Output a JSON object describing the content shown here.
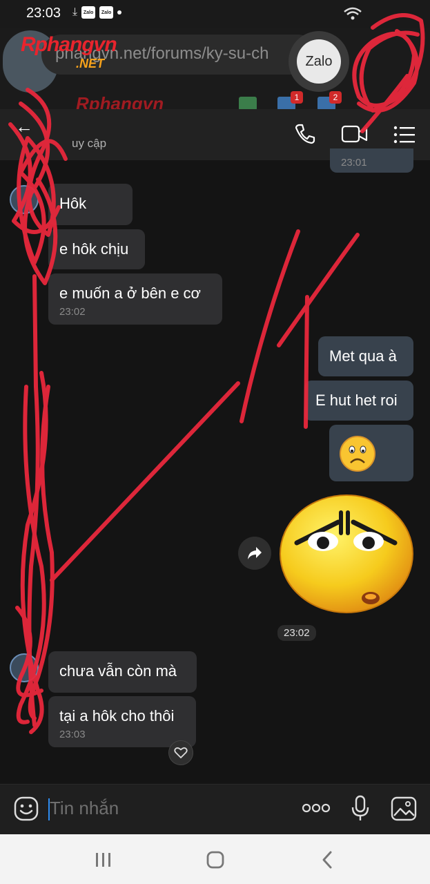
{
  "status_bar": {
    "time": "23:03",
    "app_badges": [
      "Zalo",
      "Zalo"
    ]
  },
  "browser": {
    "url_text": "phangvn.net/forums/ky-su-ch",
    "site_logo": "Rphangvn",
    "site_logo_suffix": ".NET",
    "notification_counts": [
      "1",
      "2"
    ]
  },
  "zalo_bubble": {
    "label": "Zalo"
  },
  "chat_header": {
    "subtitle": "uy cập",
    "prev_timestamp": "23:01"
  },
  "messages": [
    {
      "id": "m1",
      "side": "received",
      "text": "Hôk"
    },
    {
      "id": "m2",
      "side": "received",
      "text": "e hôk chịu"
    },
    {
      "id": "m3",
      "side": "received",
      "text": "e muốn a ở bên e cơ",
      "time": "23:02"
    },
    {
      "id": "m4",
      "side": "sent",
      "text": "Met qua à"
    },
    {
      "id": "m5",
      "side": "sent",
      "text": "E hut het roi"
    },
    {
      "id": "m6",
      "side": "sent",
      "emoji": "frowning-face-icon"
    },
    {
      "id": "m7",
      "side": "sent",
      "sticker": "sad-face-sticker",
      "time": "23:02"
    },
    {
      "id": "m8",
      "side": "received",
      "text": "chưa vẫn còn mà"
    },
    {
      "id": "m9",
      "side": "received",
      "text": "tại a hôk cho thôi",
      "time": "23:03"
    }
  ],
  "input": {
    "placeholder": "Tin nhắn"
  },
  "colors": {
    "background": "#141414",
    "received_bubble": "#2f2f31",
    "sent_bubble": "#38424d",
    "accent_caret": "#2e8cf0",
    "scribble": "#e8283c"
  }
}
